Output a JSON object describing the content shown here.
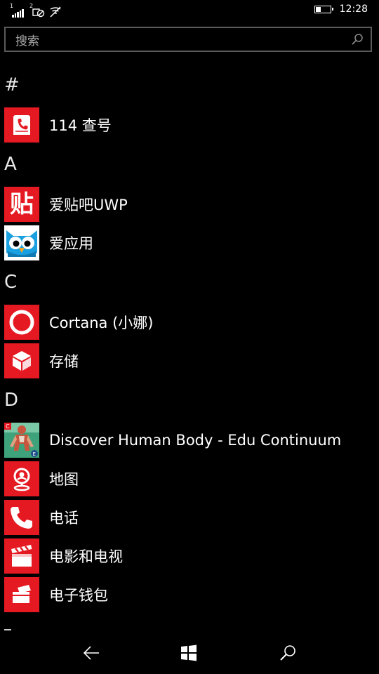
{
  "status_bar": {
    "sim1": "1",
    "sim2": "2",
    "time": "12:28",
    "battery_level": 0.35
  },
  "search": {
    "placeholder": "搜索"
  },
  "sections": [
    {
      "letter": "#",
      "apps": [
        {
          "name": "114 查号",
          "icon": "phonebook-icon"
        }
      ]
    },
    {
      "letter": "A",
      "apps": [
        {
          "name": "爱贴吧UWP",
          "icon": "tieba-icon"
        },
        {
          "name": "爱应用",
          "icon": "owl-icon"
        }
      ]
    },
    {
      "letter": "C",
      "apps": [
        {
          "name": "Cortana (小娜)",
          "icon": "cortana-ring-icon"
        },
        {
          "name": "存储",
          "icon": "storage-box-icon"
        }
      ]
    },
    {
      "letter": "D",
      "apps": [
        {
          "name": "Discover Human Body - Edu Continuum",
          "icon": "human-body-icon"
        },
        {
          "name": "地图",
          "icon": "maps-pin-icon"
        },
        {
          "name": "电话",
          "icon": "phone-handset-icon"
        },
        {
          "name": "电影和电视",
          "icon": "clapperboard-icon"
        },
        {
          "name": "电子钱包",
          "icon": "wallet-card-icon"
        }
      ]
    }
  ],
  "tiles": {
    "tieba_char": "贴",
    "human_body_badge": "C",
    "human_body_badge2": "E"
  },
  "colors": {
    "accent": "#e51922",
    "background": "#000000"
  },
  "navbar": {
    "icons": [
      "back-arrow-icon",
      "windows-start-icon",
      "search-icon"
    ]
  }
}
